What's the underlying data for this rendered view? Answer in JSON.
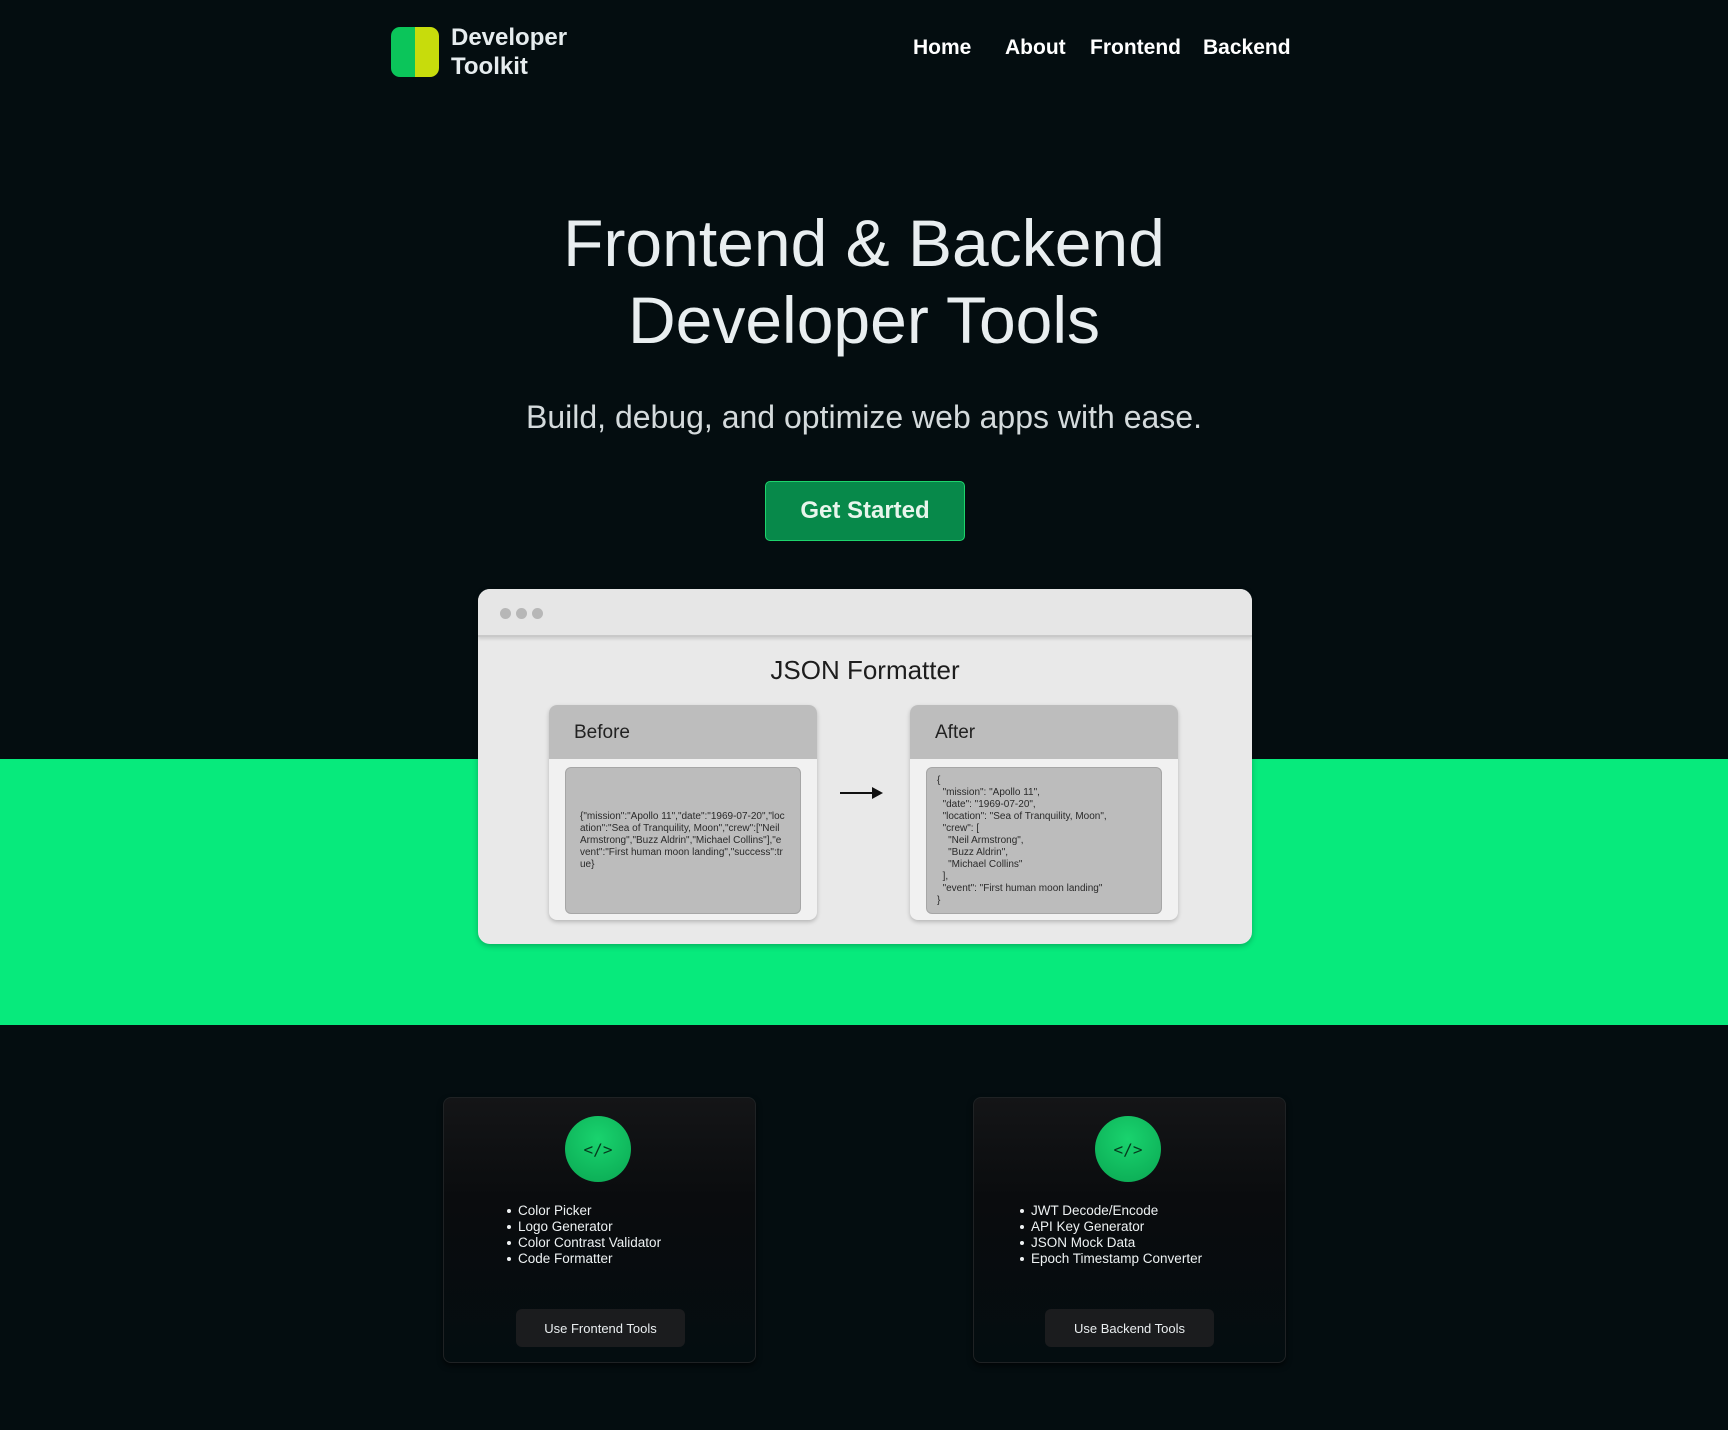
{
  "header": {
    "logo_line1": "Developer",
    "logo_line2": "Toolkit",
    "nav": [
      {
        "label": "Home"
      },
      {
        "label": "About"
      },
      {
        "label": "Frontend"
      },
      {
        "label": "Backend"
      }
    ]
  },
  "hero": {
    "title_line1": "Frontend & Backend",
    "title_line2": "Developer Tools",
    "subtitle": "Build, debug, and optimize web apps with ease.",
    "cta_label": "Get Started"
  },
  "demo": {
    "title": "JSON Formatter",
    "before_label": "Before",
    "after_label": "After",
    "before_code": "{\"mission\":\"Apollo 11\",\"date\":\"1969-07-20\",\"location\":\"Sea of Tranquility, Moon\",\"crew\":[\"Neil Armstrong\",\"Buzz Aldrin\",\"Michael Collins\"],\"event\":\"First human moon landing\",\"success\":true}",
    "after_code": "{\n  \"mission\": \"Apollo 11\",\n  \"date\": \"1969-07-20\",\n  \"location\": \"Sea of Tranquility, Moon\",\n  \"crew\": [\n    \"Neil Armstrong\",\n    \"Buzz Aldrin\",\n    \"Michael Collins\"\n  ],\n  \"event\": \"First human moon landing\"\n}"
  },
  "cards": {
    "frontend": {
      "icon": "</>",
      "items": [
        "Color Picker",
        "Logo Generator",
        "Color Contrast Validator",
        "Code Formatter"
      ],
      "button": "Use Frontend Tools"
    },
    "backend": {
      "icon": "</>",
      "items": [
        "JWT Decode/Encode",
        "API Key Generator",
        "JSON Mock Data",
        "Epoch Timestamp Converter"
      ],
      "button": "Use Backend Tools"
    }
  },
  "colors": {
    "background": "#040d10",
    "accent_green": "#07ea7c",
    "button_green": "#07894a",
    "logo_left": "#0bc55a",
    "logo_right": "#c7dc0c"
  },
  "icons": [
    "logo-mark-icon",
    "window-dots-icon",
    "arrow-right-icon",
    "code-icon"
  ]
}
